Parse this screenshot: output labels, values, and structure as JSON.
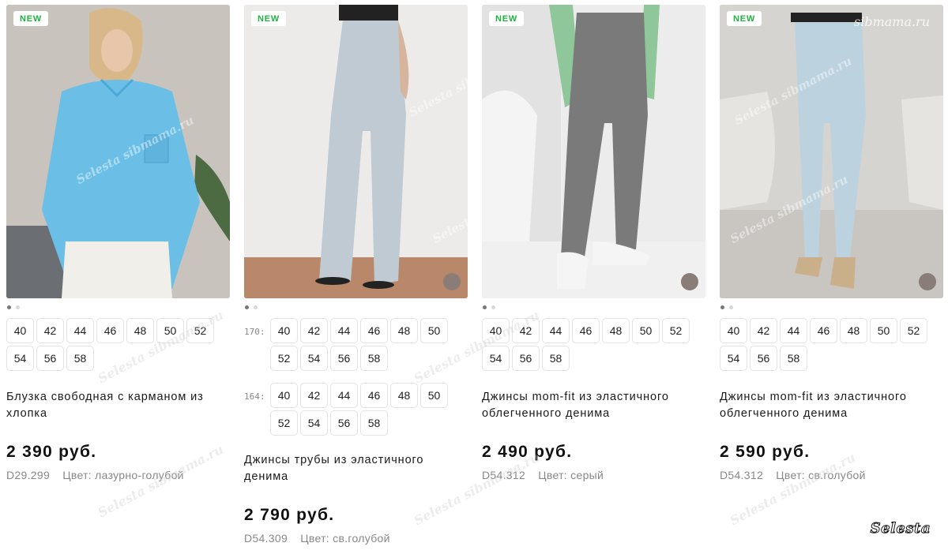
{
  "products": [
    {
      "badge": "NEW",
      "image": "Женщина в голубой блузке",
      "has_swatch": false,
      "size_rows": [
        {
          "prefix": "",
          "sizes": [
            "40",
            "42",
            "44",
            "46",
            "48",
            "50",
            "52",
            "54",
            "56",
            "58"
          ]
        }
      ],
      "title": "Блузка свободная с карманом из хлопка",
      "price": "2 390 руб.",
      "code": "D29.299",
      "color": "Цвет: лазурно-голубой"
    },
    {
      "badge": "NEW",
      "image": "Джинсы трубы светло-голубые",
      "has_swatch": true,
      "size_rows": [
        {
          "prefix": "170:",
          "sizes": [
            "40",
            "42",
            "44",
            "46",
            "48",
            "50",
            "52",
            "54",
            "56",
            "58"
          ]
        },
        {
          "prefix": "164:",
          "sizes": [
            "40",
            "42",
            "44",
            "46",
            "48",
            "50",
            "52",
            "54",
            "56",
            "58"
          ]
        }
      ],
      "title": "Джинсы трубы из эластичного денима",
      "price": "2 790 руб.",
      "code": "D54.309",
      "color": "Цвет: св.голубой"
    },
    {
      "badge": "NEW",
      "image": "Серые джинсы mom-fit",
      "has_swatch": true,
      "size_rows": [
        {
          "prefix": "",
          "sizes": [
            "40",
            "42",
            "44",
            "46",
            "48",
            "50",
            "52",
            "54",
            "56",
            "58"
          ]
        }
      ],
      "title": "Джинсы mom-fit из эластичного облегченного денима",
      "price": "2 490 руб.",
      "code": "D54.312",
      "color": "Цвет: серый"
    },
    {
      "badge": "NEW",
      "image": "Светлые джинсы mom-fit",
      "has_swatch": true,
      "size_rows": [
        {
          "prefix": "",
          "sizes": [
            "40",
            "42",
            "44",
            "46",
            "48",
            "50",
            "52",
            "54",
            "56",
            "58"
          ]
        }
      ],
      "title": "Джинсы mom-fit из эластичного облегченного денима",
      "price": "2 590 руб.",
      "code": "D54.312",
      "color": "Цвет: св.голубой"
    }
  ],
  "watermark_text": "Selesta sibmama.ru",
  "site_watermark": "sibmama.ru",
  "corner_logo": "Selesta",
  "colors": {
    "badge_green": "#1fb141",
    "swatch": "#8a7d78",
    "meta_gray": "#888888"
  }
}
